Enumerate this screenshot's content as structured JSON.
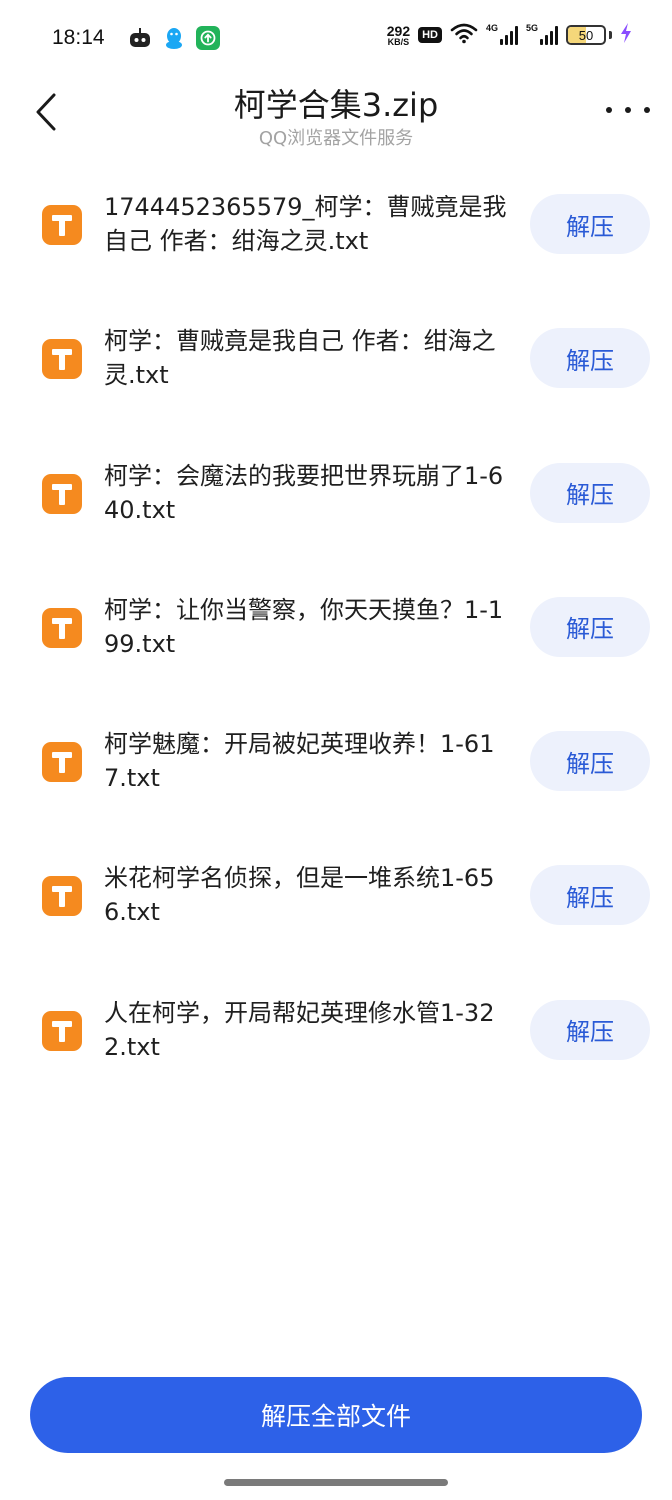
{
  "status_bar": {
    "time": "18:14",
    "app_icons": [
      "robot-app-icon",
      "qq-penguin-icon",
      "green-app-icon"
    ],
    "net_speed_value": "292",
    "net_speed_unit": "KB/S",
    "hd_label": "HD",
    "signal_1_label": "4G",
    "signal_2_label": "5G",
    "battery_level": "50",
    "battery_fill_color": "#f5d77a",
    "charging_icon": "lightning-icon"
  },
  "header": {
    "title": "柯学合集3.zip",
    "subtitle": "QQ浏览器文件服务",
    "back_icon": "back-chevron-icon",
    "more_icon": "more-dots-icon"
  },
  "files": [
    {
      "name": "1744452365579_柯学：曹贼竟是我自己 作者：绀海之灵.txt",
      "action": "解压"
    },
    {
      "name": "柯学：曹贼竟是我自己 作者：绀海之灵.txt",
      "action": "解压"
    },
    {
      "name": "柯学：会魔法的我要把世界玩崩了1-640.txt",
      "action": "解压"
    },
    {
      "name": "柯学：让你当警察，你天天摸鱼？1-199.txt",
      "action": "解压"
    },
    {
      "name": "柯学魅魔：开局被妃英理收养！1-617.txt",
      "action": "解压"
    },
    {
      "name": "米花柯学名侦探，但是一堆系统1-656.txt",
      "action": "解压"
    },
    {
      "name": "人在柯学，开局帮妃英理修水管1-322.txt",
      "action": "解压"
    }
  ],
  "file_icon": "txt-file-icon",
  "colors": {
    "accent": "#2d61e8",
    "extract_button_bg": "#edf1fc",
    "extract_button_text": "#2a5ad6",
    "file_icon_bg": "#f58a1f"
  },
  "bottom": {
    "extract_all_label": "解压全部文件"
  }
}
